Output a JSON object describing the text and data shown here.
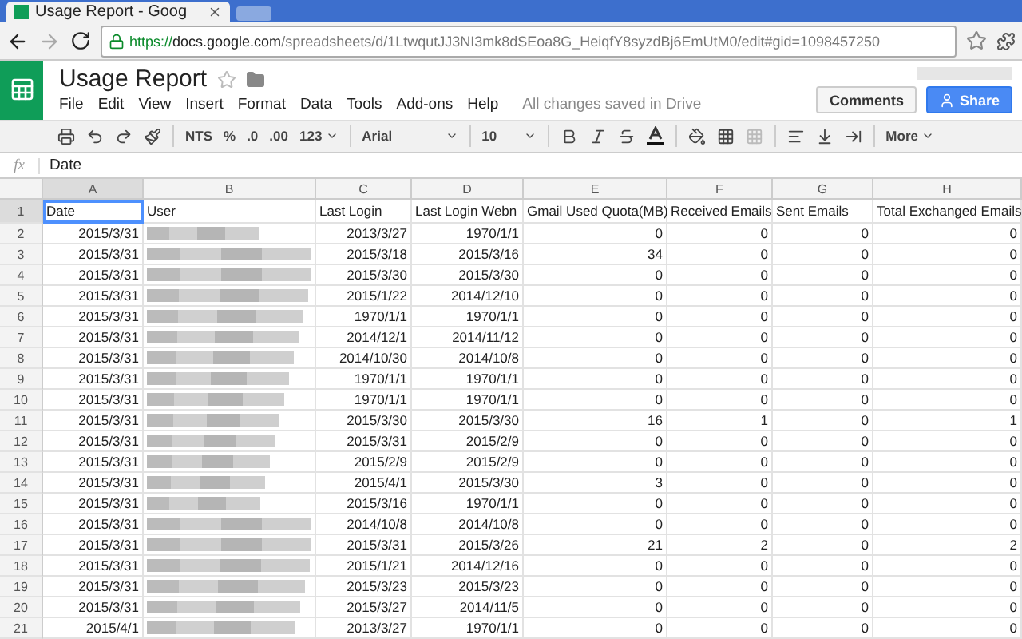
{
  "browser": {
    "tab_title": "Usage Report - Goog",
    "url_scheme": "https://",
    "url_host": "docs.google.com",
    "url_path": "/spreadsheets/d/1LtwqutJJ3NI3mk8dSEoa8G_HeiqfY8syzdBj6EmUtM0/edit#gid=1098457250"
  },
  "document": {
    "title": "Usage Report",
    "starred": false,
    "save_status": "All changes saved in Drive"
  },
  "menu": [
    "File",
    "Edit",
    "View",
    "Insert",
    "Format",
    "Data",
    "Tools",
    "Add-ons",
    "Help"
  ],
  "buttons": [
    {
      "label": "Comments",
      "kind": "plain"
    },
    {
      "label": "Share",
      "kind": "primary"
    }
  ],
  "toolbar": {
    "currency": "NTS",
    "percent": "%",
    "decrease_decimals": ".0",
    "increase_decimals": ".00",
    "number_format": "123",
    "font": "Arial",
    "font_size": "10",
    "more": "More"
  },
  "formula_bar": {
    "fx": "fx",
    "value": "Date"
  },
  "columns": [
    {
      "label": "A",
      "selected": true
    },
    {
      "label": "B",
      "selected": false
    },
    {
      "label": "C",
      "selected": false
    },
    {
      "label": "D",
      "selected": false
    },
    {
      "label": "E",
      "selected": false
    },
    {
      "label": "F",
      "selected": false
    },
    {
      "label": "G",
      "selected": false
    },
    {
      "label": "H",
      "selected": false
    }
  ],
  "header_row": {
    "n": "1",
    "selected": true,
    "cells": [
      {
        "text": "Date",
        "selected": true
      },
      {
        "text": "User",
        "selected": false
      },
      {
        "text": "Last Login",
        "selected": false
      },
      {
        "text": "Last Login Webn",
        "selected": false
      },
      {
        "text": "Gmail Used Quota(MB)",
        "selected": false
      },
      {
        "text": "Received Emails",
        "selected": false
      },
      {
        "text": "Sent Emails",
        "selected": false
      },
      {
        "text": "Total Exchanged Emails",
        "selected": false
      }
    ]
  },
  "rows": [
    {
      "n": "2",
      "selected": false,
      "cells": [
        "2015/3/31",
        "2013/3/27",
        "1970/1/1",
        "0",
        "0",
        "0",
        "0"
      ]
    },
    {
      "n": "3",
      "selected": false,
      "cells": [
        "2015/3/31",
        "2015/3/18",
        "2015/3/16",
        "34",
        "0",
        "0",
        "0"
      ]
    },
    {
      "n": "4",
      "selected": false,
      "cells": [
        "2015/3/31",
        "2015/3/30",
        "2015/3/30",
        "0",
        "0",
        "0",
        "0"
      ]
    },
    {
      "n": "5",
      "selected": false,
      "cells": [
        "2015/3/31",
        "2015/1/22",
        "2014/12/10",
        "0",
        "0",
        "0",
        "0"
      ]
    },
    {
      "n": "6",
      "selected": false,
      "cells": [
        "2015/3/31",
        "1970/1/1",
        "1970/1/1",
        "0",
        "0",
        "0",
        "0"
      ]
    },
    {
      "n": "7",
      "selected": false,
      "cells": [
        "2015/3/31",
        "2014/12/1",
        "2014/11/12",
        "0",
        "0",
        "0",
        "0"
      ]
    },
    {
      "n": "8",
      "selected": false,
      "cells": [
        "2015/3/31",
        "2014/10/30",
        "2014/10/8",
        "0",
        "0",
        "0",
        "0"
      ]
    },
    {
      "n": "9",
      "selected": false,
      "cells": [
        "2015/3/31",
        "1970/1/1",
        "1970/1/1",
        "0",
        "0",
        "0",
        "0"
      ]
    },
    {
      "n": "10",
      "selected": false,
      "cells": [
        "2015/3/31",
        "1970/1/1",
        "1970/1/1",
        "0",
        "0",
        "0",
        "0"
      ]
    },
    {
      "n": "11",
      "selected": false,
      "cells": [
        "2015/3/31",
        "2015/3/30",
        "2015/3/30",
        "16",
        "1",
        "0",
        "1"
      ]
    },
    {
      "n": "12",
      "selected": false,
      "cells": [
        "2015/3/31",
        "2015/3/31",
        "2015/2/9",
        "0",
        "0",
        "0",
        "0"
      ]
    },
    {
      "n": "13",
      "selected": false,
      "cells": [
        "2015/3/31",
        "2015/2/9",
        "2015/2/9",
        "0",
        "0",
        "0",
        "0"
      ]
    },
    {
      "n": "14",
      "selected": false,
      "cells": [
        "2015/3/31",
        "2015/4/1",
        "2015/3/30",
        "3",
        "0",
        "0",
        "0"
      ]
    },
    {
      "n": "15",
      "selected": false,
      "cells": [
        "2015/3/31",
        "2015/3/16",
        "1970/1/1",
        "0",
        "0",
        "0",
        "0"
      ]
    },
    {
      "n": "16",
      "selected": false,
      "cells": [
        "2015/3/31",
        "2014/10/8",
        "2014/10/8",
        "0",
        "0",
        "0",
        "0"
      ]
    },
    {
      "n": "17",
      "selected": false,
      "cells": [
        "2015/3/31",
        "2015/3/31",
        "2015/3/26",
        "21",
        "2",
        "0",
        "2"
      ]
    },
    {
      "n": "18",
      "selected": false,
      "cells": [
        "2015/3/31",
        "2015/1/21",
        "2014/12/16",
        "0",
        "0",
        "0",
        "0"
      ]
    },
    {
      "n": "19",
      "selected": false,
      "cells": [
        "2015/3/31",
        "2015/3/23",
        "2015/3/23",
        "0",
        "0",
        "0",
        "0"
      ]
    },
    {
      "n": "20",
      "selected": false,
      "cells": [
        "2015/3/31",
        "2015/3/27",
        "2014/11/5",
        "0",
        "0",
        "0",
        "0"
      ]
    },
    {
      "n": "21",
      "selected": false,
      "cells": [
        "2015/4/1",
        "2013/3/27",
        "1970/1/1",
        "0",
        "0",
        "0",
        "0"
      ]
    }
  ]
}
